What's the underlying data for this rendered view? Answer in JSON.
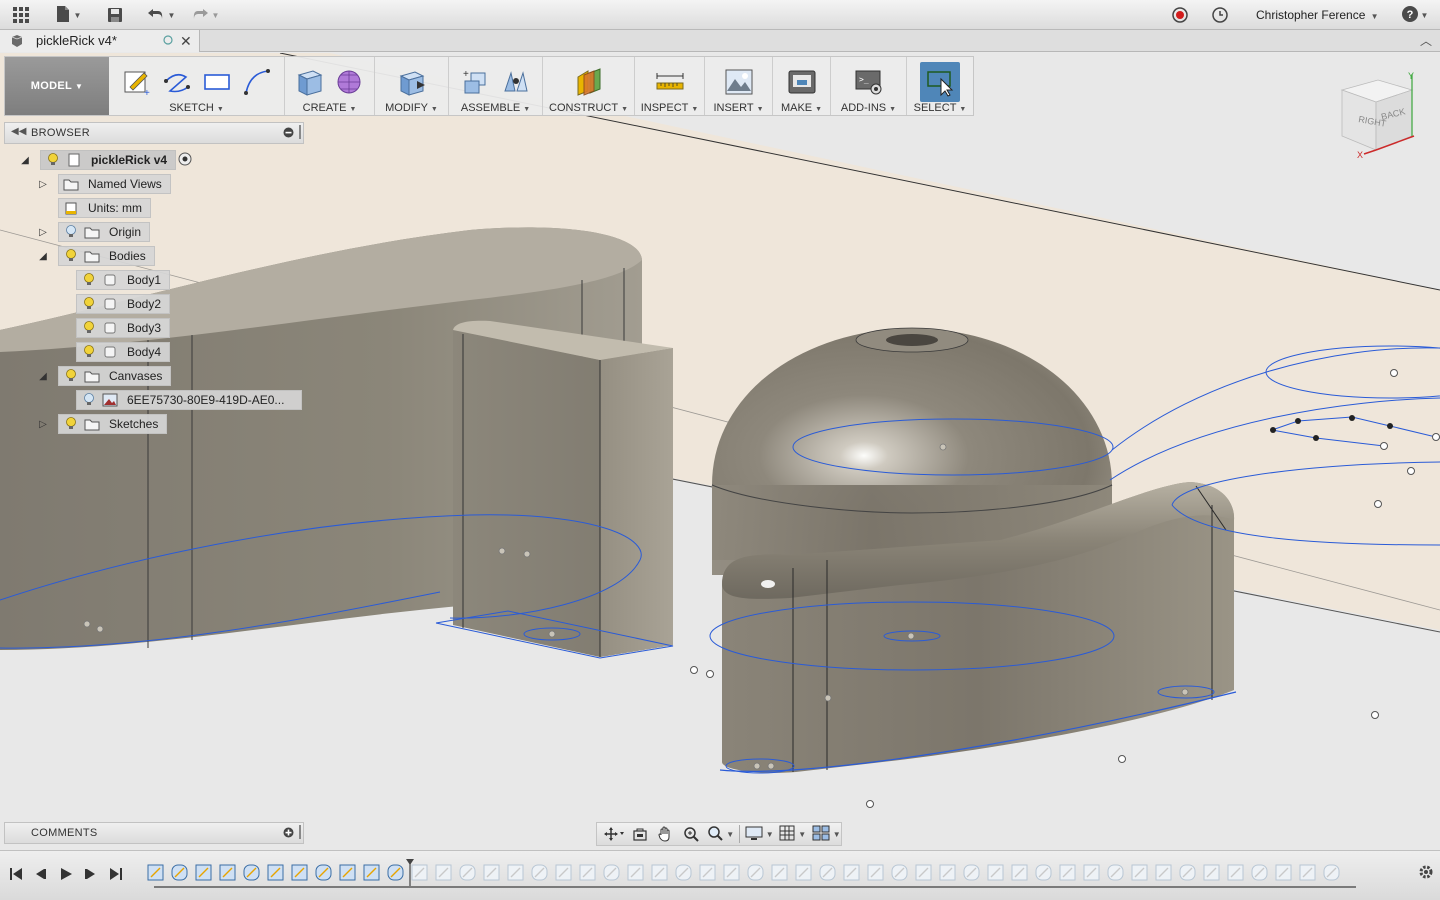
{
  "app": {
    "user_name": "Christopher Ference",
    "icons": [
      "grid-icon",
      "file-icon",
      "save-icon",
      "undo-icon",
      "redo-icon",
      "record-icon",
      "clock-icon",
      "help-icon"
    ]
  },
  "document": {
    "tab_title": "pickleRick v4*"
  },
  "toolbar": {
    "workspace": "MODEL",
    "groups": [
      {
        "label": "SKETCH"
      },
      {
        "label": "CREATE"
      },
      {
        "label": "MODIFY"
      },
      {
        "label": "ASSEMBLE"
      },
      {
        "label": "CONSTRUCT"
      },
      {
        "label": "INSPECT"
      },
      {
        "label": "INSERT"
      },
      {
        "label": "MAKE"
      },
      {
        "label": "ADD-INS"
      },
      {
        "label": "SELECT"
      }
    ]
  },
  "browser": {
    "title": "BROWSER",
    "root": "pickleRick v4",
    "items": [
      {
        "label": "Named Views"
      },
      {
        "label": "Units: mm"
      },
      {
        "label": "Origin"
      },
      {
        "label": "Bodies"
      },
      {
        "label": "Body1"
      },
      {
        "label": "Body2"
      },
      {
        "label": "Body3"
      },
      {
        "label": "Body4"
      },
      {
        "label": "Canvases"
      },
      {
        "label": "6EE75730-80E9-419D-AE0..."
      },
      {
        "label": "Sketches"
      }
    ]
  },
  "comments": {
    "title": "COMMENTS"
  },
  "viewcube": {
    "face_left": "RIGHT",
    "face_right": "BACK",
    "axis_y": "Y",
    "axis_x": "X"
  },
  "colors": {
    "select_active": "#4f86b8",
    "sketch_line": "#2a5bd7",
    "body_surface": "#8a8478",
    "canvas_plane": "#efe6da"
  }
}
